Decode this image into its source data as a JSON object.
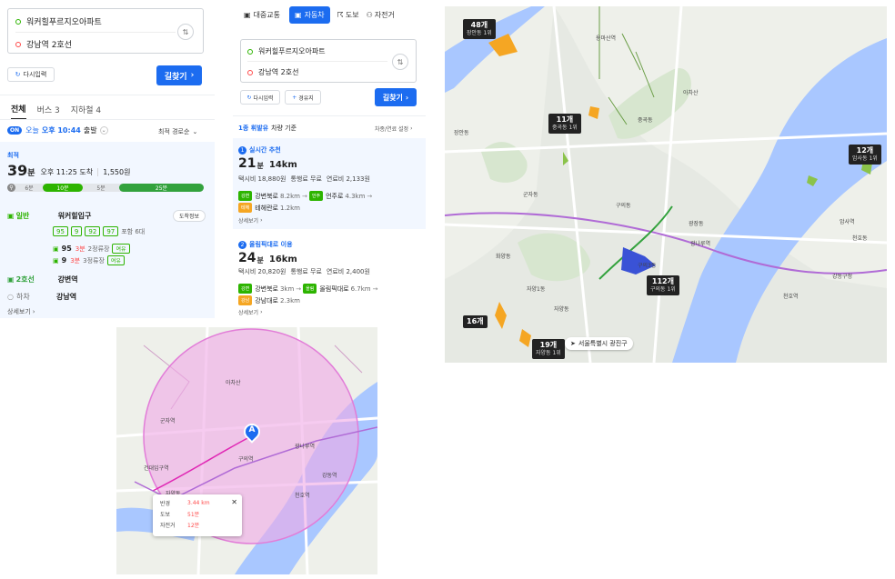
{
  "panel_a": {
    "origin": "워커힐푸르지오아파트",
    "destination": "강남역 2호선",
    "reset_label": "다시입력",
    "search_label": "길찾기",
    "tabs": [
      "전체",
      "버스 3",
      "지하철 4"
    ],
    "on_badge": "ON",
    "depart_prefix": "오늘",
    "depart_time": "오후 10:44",
    "depart_suffix": "출발",
    "sort_label": "최적 경로순",
    "best_label": "최적",
    "duration_num": "39",
    "duration_unit": "분",
    "arrival": "오후 11:25 도착",
    "fare": "1,550원",
    "seg_walk1": "6분",
    "seg_bus": "10분",
    "seg_walk2": "5분",
    "seg_subway": "25분",
    "bus_type": "일반",
    "bus_stop": "워커힐입구",
    "arrival_info_btn": "도착정보",
    "bus_numbers": [
      "95",
      "9",
      "92",
      "97"
    ],
    "bus_more": "포함 6대",
    "bus_95_num": "95",
    "bus_95_min": "3분",
    "bus_95_stops": "2정류장",
    "bus_95_tag": "여유",
    "bus_9_num": "9",
    "bus_9_min": "3분",
    "bus_9_stops": "3정류장",
    "bus_9_tag": "여유",
    "subway_line": "2호선",
    "subway_station": "강변역",
    "alight_label": "하차",
    "alight_station": "강남역",
    "detail_label": "상세보기"
  },
  "panel_b": {
    "modes": [
      "대중교통",
      "자동차",
      "도보",
      "자전거"
    ],
    "active_mode": "자동차",
    "origin": "워커힐푸르지오아파트",
    "destination": "강남역 2호선",
    "reset_label": "다시입력",
    "waypoint_label": "경유지",
    "search_label": "길찾기",
    "vehicle_class": "1종 휘발유",
    "vehicle_suffix": "차량 기준",
    "setting_label": "차종/연료 설정",
    "route1": {
      "tag": "실시간 추천",
      "min": "21",
      "min_unit": "분",
      "dist": "14km",
      "taxi": "택시비 18,880원",
      "toll": "통행료 무료",
      "fuel": "연료비 2,133원",
      "road1_tag": "강변",
      "road1": "강변북로",
      "road1_km": "8.2km",
      "road2_tag": "언주",
      "road2": "언주로",
      "road2_km": "4.3km",
      "road3_tag": "테헤",
      "road3": "테헤란로",
      "road3_km": "1.2km",
      "detail": "상세보기"
    },
    "route2": {
      "tag": "올림픽대로 이용",
      "min": "24",
      "min_unit": "분",
      "dist": "16km",
      "taxi": "택시비 20,820원",
      "toll": "통행료 무료",
      "fuel": "연료비 2,400원",
      "road1_tag": "강변",
      "road1": "강변북로",
      "road1_km": "3km",
      "road2_tag": "올림",
      "road2": "올림픽대로",
      "road2_km": "6.7km",
      "road3_tag": "강남",
      "road3": "강남대로",
      "road3_km": "2.3km",
      "detail": "상세보기"
    }
  },
  "panel_c": {
    "markers": [
      {
        "n": "48개",
        "s": "장안동 1위"
      },
      {
        "n": "11개",
        "s": "중곡동 1위"
      },
      {
        "n": "12개",
        "s": "암사동 1위"
      },
      {
        "n": "112개",
        "s": "구의동 1위"
      },
      {
        "n": "16개",
        "s": ""
      },
      {
        "n": "19개",
        "s": "자양동 1위"
      }
    ],
    "region_label": "서울특별시 광진구",
    "labels": {
      "l1": "중곡동",
      "l2": "용마산역",
      "l3": "아차산",
      "l4": "광장동",
      "l5": "광나루역",
      "l6": "천호역",
      "l7": "암사역",
      "l8": "구의동",
      "l9": "자양동",
      "l10": "군자동",
      "l11": "화양동",
      "l12": "장안동",
      "l13": "강동구청",
      "l14": "천호동",
      "l15": "구의3동",
      "l16": "자양1동"
    }
  },
  "panel_d": {
    "marker_letter": "A",
    "radius_label": "반경",
    "radius_value": "3.44 km",
    "walk_label": "도보",
    "walk_value": "51분",
    "bike_label": "자전거",
    "bike_value": "12분",
    "close_glyph": "✕",
    "labels": {
      "l1": "아차산",
      "l2": "구의역",
      "l3": "광나루역",
      "l4": "천호역",
      "l5": "강동역",
      "l6": "건대입구역",
      "l7": "자양동",
      "l8": "군자역"
    }
  },
  "colors": {
    "accent": "#1c6cf0",
    "bus_green": "#2db400",
    "subway_green": "#33a23d",
    "badge_blue": "#1c6cf0",
    "time_red": "#ff4a4a",
    "circle_pink": "#f0a8e6",
    "water_blue": "#a9c7ff"
  }
}
